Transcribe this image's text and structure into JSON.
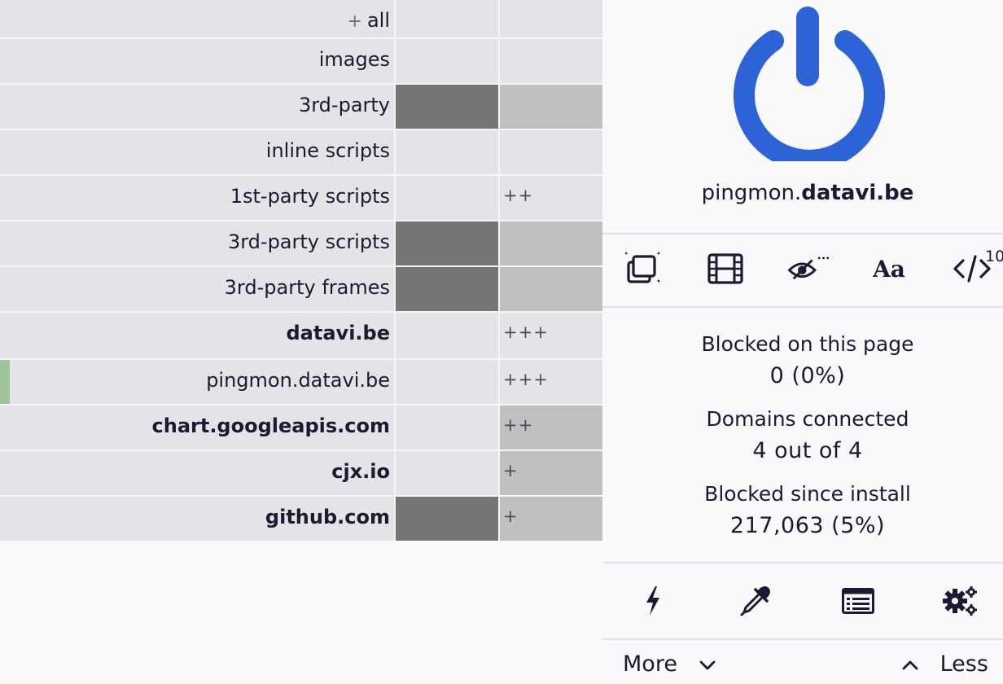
{
  "firewall": {
    "rows": [
      {
        "label": "all",
        "prefix": "+",
        "bold": false,
        "global": "",
        "local": "",
        "local_text": ""
      },
      {
        "label": "images",
        "prefix": "",
        "bold": false,
        "global": "",
        "local": "",
        "local_text": ""
      },
      {
        "label": "3rd-party",
        "prefix": "",
        "bold": false,
        "global": "block",
        "local": "block-light",
        "local_text": ""
      },
      {
        "label": "inline scripts",
        "prefix": "",
        "bold": false,
        "global": "",
        "local": "",
        "local_text": ""
      },
      {
        "label": "1st-party scripts",
        "prefix": "",
        "bold": false,
        "global": "",
        "local": "",
        "local_text": "++"
      },
      {
        "label": "3rd-party scripts",
        "prefix": "",
        "bold": false,
        "global": "block",
        "local": "block-light",
        "local_text": ""
      },
      {
        "label": "3rd-party frames",
        "prefix": "",
        "bold": false,
        "global": "block",
        "local": "block-light",
        "local_text": ""
      },
      {
        "label": "datavi.be",
        "prefix": "",
        "bold": true,
        "global": "",
        "local": "",
        "local_text": "+++"
      },
      {
        "label": "pingmon.datavi.be",
        "prefix": "",
        "bold": false,
        "global": "",
        "local": "",
        "local_text": "+++"
      },
      {
        "label": "chart.googleapis.com",
        "prefix": "",
        "bold": true,
        "global": "",
        "local": "block-light",
        "local_text": "++"
      },
      {
        "label": "cjx.io",
        "prefix": "",
        "bold": true,
        "global": "",
        "local": "block-light",
        "local_text": "+"
      },
      {
        "label": "github.com",
        "prefix": "",
        "bold": true,
        "global": "block",
        "local": "block-light",
        "local_text": "+"
      }
    ]
  },
  "panel": {
    "hostname_sub": "pingmon.",
    "hostname_domain": "datavi.be",
    "power_icon": "power-icon",
    "power_color": "#2c64d8",
    "tools": [
      {
        "name": "popup-blocker-icon"
      },
      {
        "name": "media-film-icon"
      },
      {
        "name": "cosmetic-filter-eye-icon"
      },
      {
        "name": "remote-fonts-icon",
        "glyph": "Aa"
      },
      {
        "name": "scripts-code-icon"
      }
    ],
    "scripts_badge": "10",
    "stats": [
      {
        "label": "Blocked on this page",
        "value": "0 (0%)"
      },
      {
        "label": "Domains connected",
        "value": "4 out of 4"
      },
      {
        "label": "Blocked since install",
        "value": "217,063 (5%)"
      }
    ],
    "bottom_tools": [
      "zap-icon",
      "eyedropper-icon",
      "logger-icon",
      "dashboard-gears-icon"
    ],
    "more_label": "More",
    "less_label": "Less"
  }
}
